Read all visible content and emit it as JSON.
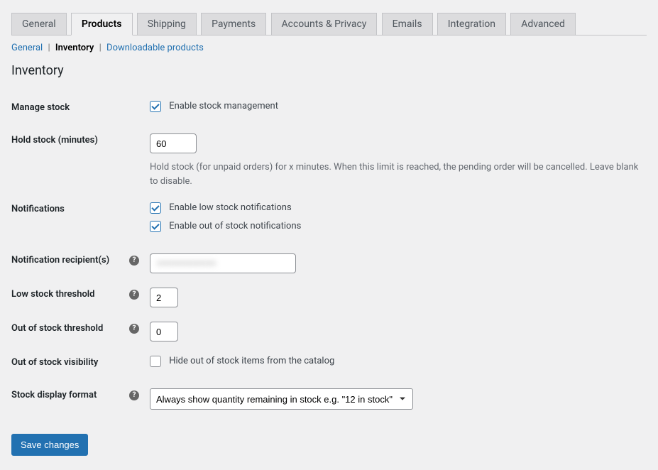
{
  "tabs": {
    "general": "General",
    "products": "Products",
    "shipping": "Shipping",
    "payments": "Payments",
    "accounts_privacy": "Accounts & Privacy",
    "emails": "Emails",
    "integration": "Integration",
    "advanced": "Advanced"
  },
  "subnav": {
    "general": "General",
    "inventory": "Inventory",
    "downloadable": "Downloadable products"
  },
  "section_title": "Inventory",
  "fields": {
    "manage_stock": {
      "label": "Manage stock",
      "checkbox_label": "Enable stock management",
      "checked": true
    },
    "hold_stock": {
      "label": "Hold stock (minutes)",
      "value": "60",
      "description": "Hold stock (for unpaid orders) for x minutes. When this limit is reached, the pending order will be cancelled. Leave blank to disable."
    },
    "notifications": {
      "label": "Notifications",
      "low_stock_label": "Enable low stock notifications",
      "low_stock_checked": true,
      "out_of_stock_label": "Enable out of stock notifications",
      "out_of_stock_checked": true
    },
    "recipient": {
      "label": "Notification recipient(s)",
      "value": ""
    },
    "low_stock_threshold": {
      "label": "Low stock threshold",
      "value": "2"
    },
    "out_of_stock_threshold": {
      "label": "Out of stock threshold",
      "value": "0"
    },
    "out_of_stock_visibility": {
      "label": "Out of stock visibility",
      "checkbox_label": "Hide out of stock items from the catalog",
      "checked": false
    },
    "stock_display_format": {
      "label": "Stock display format",
      "selected": "Always show quantity remaining in stock e.g. \"12 in stock\""
    }
  },
  "save_button": "Save changes"
}
